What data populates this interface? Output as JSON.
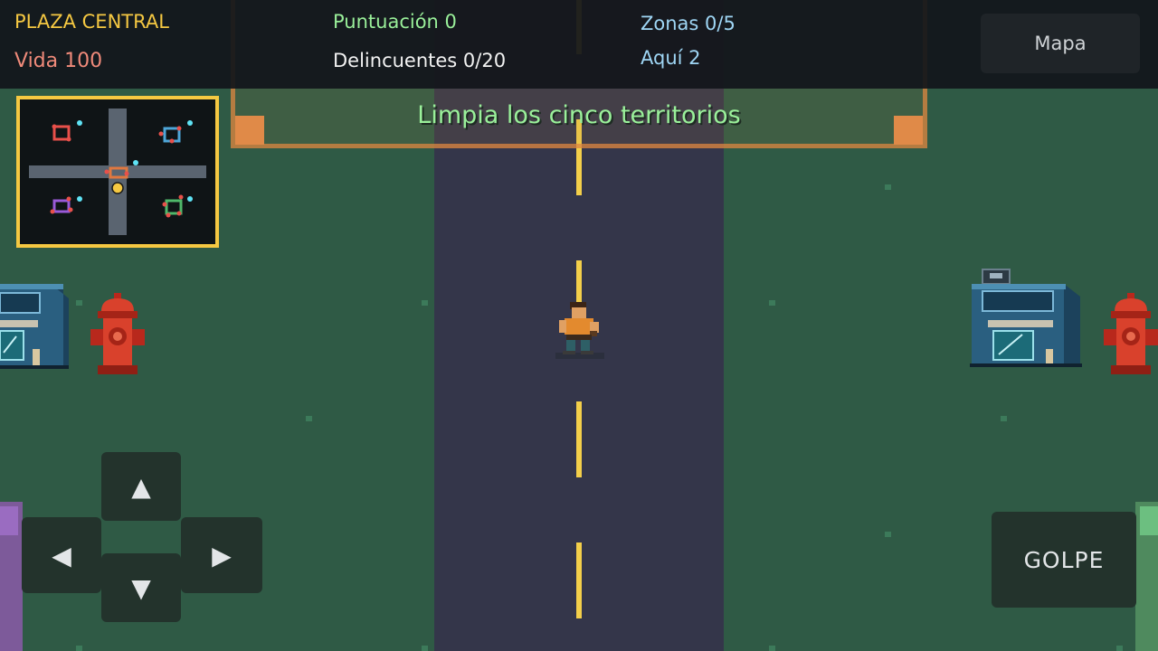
{
  "hud": {
    "location": "PLAZA CENTRAL",
    "health": "Vida 100",
    "score": "Puntuación 0",
    "criminals": "Delincuentes 0/20",
    "zones": "Zonas 0/5",
    "here": "Aquí 2",
    "map_button": "Mapa"
  },
  "objective": "Limpia los cinco territorios",
  "controls": {
    "up": "▲",
    "down": "▼",
    "left": "◀",
    "right": "▶",
    "attack": "GOLPE"
  },
  "colors": {
    "grass": "#2f5a45",
    "road": "#34364a",
    "lane": "#f3cf4a",
    "minimap_border": "#f5c842"
  }
}
